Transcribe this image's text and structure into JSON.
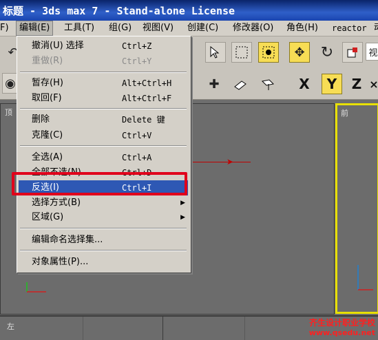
{
  "window": {
    "title": "标题 - 3ds max 7  - Stand-alone License"
  },
  "menubar": {
    "items": [
      "F)",
      "编辑(E)",
      "工具(T)",
      "组(G)",
      "视图(V)",
      "创建(C)",
      "修改器(O)",
      "角色(H)",
      "reactor",
      "动"
    ]
  },
  "toolbar": {
    "view_dropdown_text": "视",
    "axes": [
      "X",
      "Y",
      "Z"
    ],
    "active_axis": "Y"
  },
  "viewports": {
    "top_label": "顶",
    "front_label": "前",
    "left_label": "左"
  },
  "edit_menu": {
    "items": [
      {
        "label": "撤消(U) 选择",
        "shortcut": "Ctrl+Z",
        "enabled": true
      },
      {
        "label": "重做(R)",
        "shortcut": "Ctrl+Y",
        "enabled": false
      },
      {
        "label": "暂存(H)",
        "shortcut": "Alt+Ctrl+H",
        "enabled": true
      },
      {
        "label": "取回(F)",
        "shortcut": "Alt+Ctrl+F",
        "enabled": true
      },
      {
        "label": "删除",
        "shortcut": "Delete 键",
        "enabled": true
      },
      {
        "label": "克隆(C)",
        "shortcut": "Ctrl+V",
        "enabled": true
      },
      {
        "label": "全选(A)",
        "shortcut": "Ctrl+A",
        "enabled": true
      },
      {
        "label": "全部不选(N)",
        "shortcut": "Ctrl+D",
        "enabled": true
      },
      {
        "label": "反选(I)",
        "shortcut": "Ctrl+I",
        "enabled": true,
        "selected": true
      },
      {
        "label": "选择方式(B)",
        "shortcut": "",
        "submenu": true
      },
      {
        "label": "区域(G)",
        "shortcut": "",
        "submenu": true
      },
      {
        "label": "编辑命名选择集...",
        "shortcut": ""
      },
      {
        "label": "对象属性(P)...",
        "shortcut": ""
      }
    ]
  },
  "watermark": {
    "line1": "齐生设计职业学校",
    "line2": "www.qsedu.net"
  },
  "colors": {
    "selection": "#2e58b4",
    "highlight_box": "#e0001b",
    "active_axis": "#f7dd55",
    "viewport_border_active": "#e8e000"
  }
}
